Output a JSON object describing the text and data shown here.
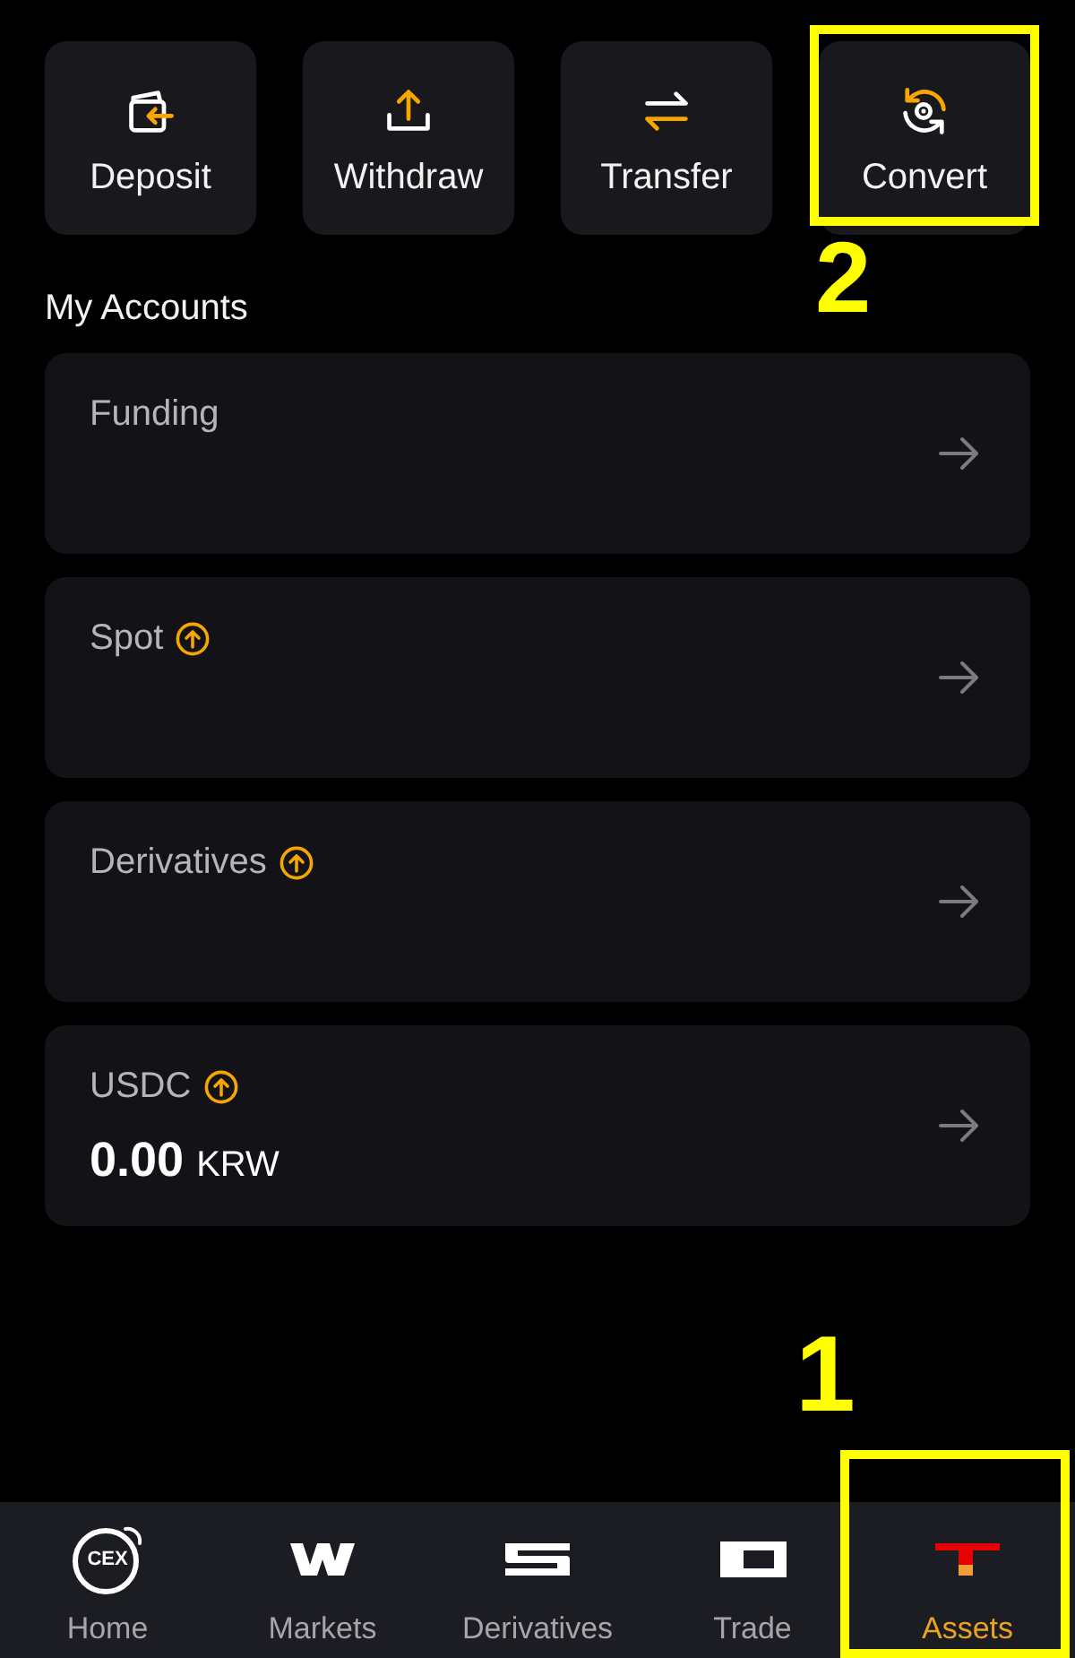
{
  "actions": [
    {
      "kind": "deposit",
      "label": "Deposit"
    },
    {
      "kind": "withdraw",
      "label": "Withdraw"
    },
    {
      "kind": "transfer",
      "label": "Transfer"
    },
    {
      "kind": "convert",
      "label": "Convert",
      "callout": "2"
    }
  ],
  "accounts_heading": "My Accounts",
  "accounts": [
    {
      "title": "Funding",
      "upgrade_badge": false
    },
    {
      "title": "Spot",
      "upgrade_badge": true
    },
    {
      "title": "Derivatives",
      "upgrade_badge": true
    },
    {
      "title": "USDC",
      "upgrade_badge": true,
      "balance": {
        "amount": "0.00",
        "currency": "KRW"
      }
    }
  ],
  "bottom_nav": [
    {
      "kind": "home",
      "label": "Home",
      "logo_text": "CEX",
      "selected": false
    },
    {
      "kind": "markets",
      "label": "Markets",
      "selected": false
    },
    {
      "kind": "derivatives",
      "label": "Derivatives",
      "selected": false
    },
    {
      "kind": "trade",
      "label": "Trade",
      "selected": false
    },
    {
      "kind": "assets",
      "label": "Assets",
      "selected": true,
      "callout": "1"
    }
  ]
}
